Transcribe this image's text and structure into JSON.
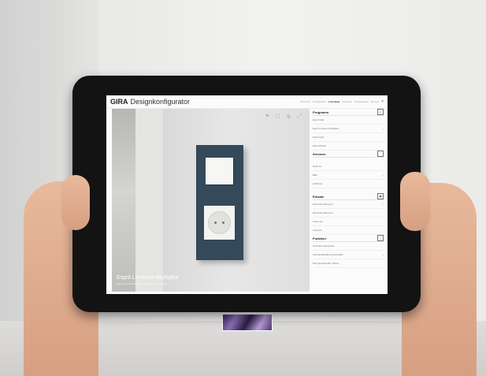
{
  "app": {
    "brand": "GIRA",
    "title": "Designkonfigurator",
    "nav": [
      {
        "label": "Übersicht",
        "active": false
      },
      {
        "label": "Konfiguration",
        "active": false
      },
      {
        "label": "Live-View",
        "active": true
      },
      {
        "label": "Favoriten",
        "active": false
      },
      {
        "label": "Designpalette",
        "active": false
      },
      {
        "label": "Ein aus",
        "active": false
      }
    ],
    "close_label": "×"
  },
  "stage": {
    "tools": [
      "♥",
      "☐",
      "⊕",
      "⤢"
    ],
    "title": "Esprit Linoleum-Multiplex",
    "subtitle": "Esprit Linoleum-Multiplex Anthrazit Dunkelbraun"
  },
  "panel": {
    "sections": [
      {
        "title": "Programm",
        "icon": "link-icon",
        "items": [
          {
            "label": "Esprit Glas",
            "chevron": false
          },
          {
            "label": "Esprit Linoleum-Multiplex",
            "chevron": true
          },
          {
            "label": "Esprit Holz",
            "chevron": false
          },
          {
            "label": "Esprit Metall",
            "chevron": false
          }
        ]
      },
      {
        "title": "Services",
        "icon": "square-icon",
        "items": [
          {
            "label": "Rahmen",
            "chevron": false
          },
          {
            "label": "Blau",
            "chevron": true
          },
          {
            "label": "Hellbraun",
            "chevron": false
          }
        ]
      },
      {
        "title": "Einsatz",
        "icon": "grid-icon",
        "items": [
          {
            "label": "Reinweiß glänzend",
            "chevron": true
          },
          {
            "label": "Reinweiß glänzend",
            "chevron": false
          },
          {
            "label": "Farbe alu",
            "chevron": false
          },
          {
            "label": "Anthrazit",
            "chevron": false
          }
        ]
      },
      {
        "title": "Funktion",
        "icon": "circle-icon",
        "items": [
          {
            "label": "SCHUKO Steckdose",
            "chevron": false
          },
          {
            "label": "Wechselschalter/Ausschalter",
            "chevron": true
          },
          {
            "label": "Mehrgangschalter Wippe",
            "chevron": false
          }
        ]
      }
    ]
  },
  "colors": {
    "frame": "#34495a",
    "bezel": "#131313",
    "accent_text": "#222222"
  }
}
